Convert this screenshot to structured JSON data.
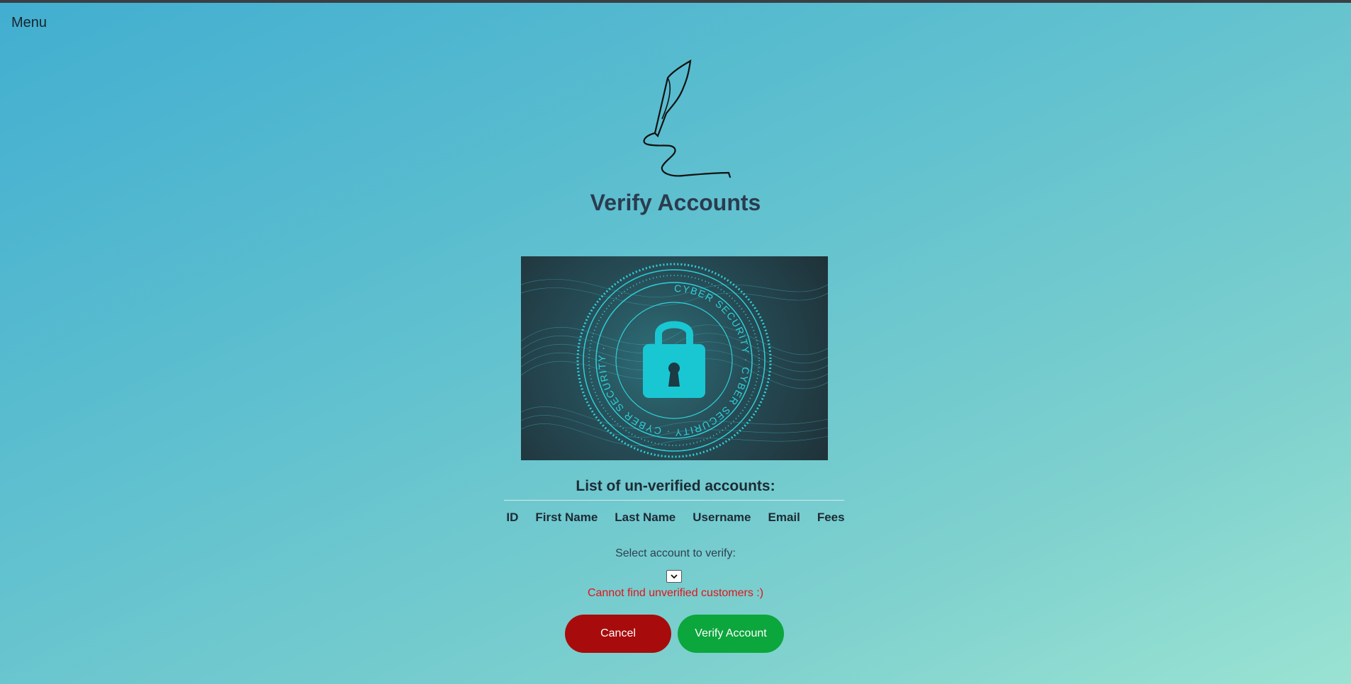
{
  "nav": {
    "menu_label": "Menu"
  },
  "page": {
    "title": "Verify Accounts"
  },
  "hero": {
    "icon": "lock-icon",
    "ring_text": "CYBER SECURITY · CYBER SECURITY · CYBER SECURITY ·"
  },
  "accounts": {
    "heading": "List of un-verified accounts:",
    "columns": [
      "ID",
      "First Name",
      "Last Name",
      "Username",
      "Email",
      "Fees"
    ]
  },
  "form": {
    "select_prompt": "Select account to verify:",
    "error_message": "Cannot find unverified customers :)",
    "cancel_label": "Cancel",
    "verify_label": "Verify Account"
  },
  "colors": {
    "cancel": "#a80b0b",
    "verify": "#0ba63c",
    "error": "#e0141c"
  }
}
